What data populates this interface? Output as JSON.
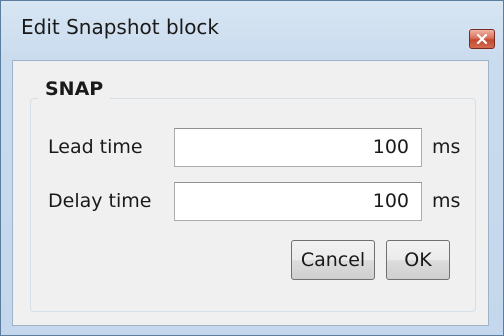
{
  "window": {
    "title": "Edit Snapshot block"
  },
  "group": {
    "label": "SNAP"
  },
  "fields": [
    {
      "label": "Lead time",
      "value": "100",
      "unit": "ms"
    },
    {
      "label": "Delay time",
      "value": "100",
      "unit": "ms"
    }
  ],
  "buttons": {
    "cancel_label": "Cancel",
    "ok_label": "OK"
  },
  "icons": {
    "close": "close-icon"
  },
  "colors": {
    "close_button": "#c9553d",
    "window_frame": "#c4d7ec",
    "client_bg": "#f0f0f0"
  }
}
